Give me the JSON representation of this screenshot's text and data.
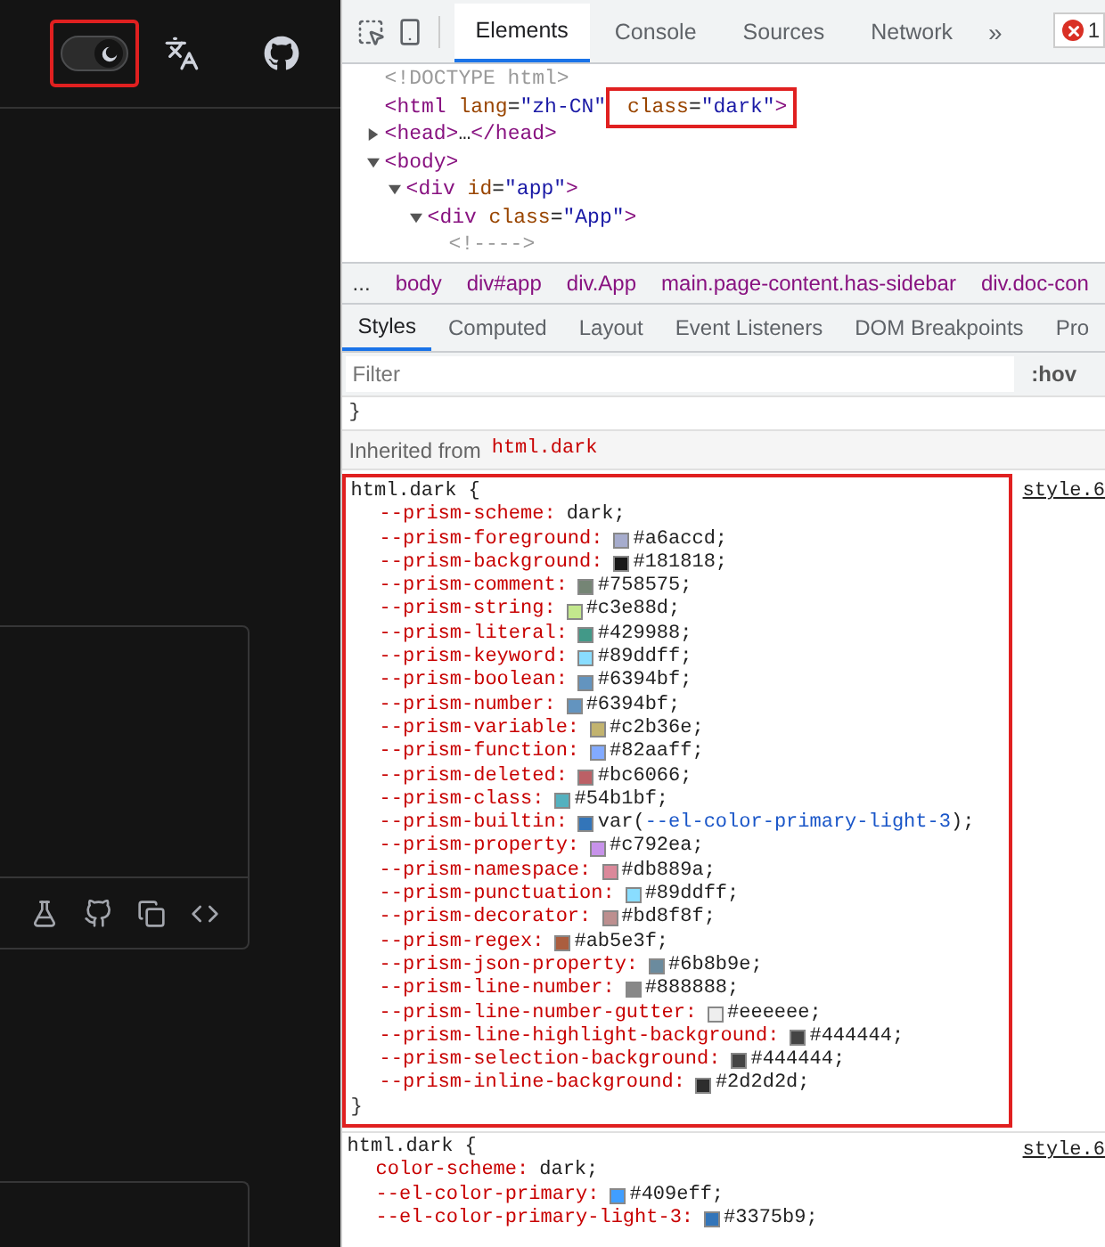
{
  "site_header": {
    "theme_switch": {
      "on": true
    }
  },
  "devtools": {
    "tabs": [
      {
        "label": "Elements",
        "selected": true
      },
      {
        "label": "Console",
        "selected": false
      },
      {
        "label": "Sources",
        "selected": false
      },
      {
        "label": "Network",
        "selected": false
      }
    ],
    "more_tabs": "»",
    "error_count": "1",
    "dom_tree": [
      {
        "tokens": [
          {
            "t": "<!DOCTYPE html>",
            "kind": "comment"
          }
        ]
      },
      {
        "tokens": [
          {
            "t": "<html",
            "kind": "tag"
          },
          {
            "t": " lang",
            "kind": "attr"
          },
          {
            "t": "=",
            "kind": "plain"
          },
          {
            "t": "\"zh-CN\"",
            "kind": "value"
          },
          {
            "t": " class",
            "kind": "attr",
            "boxed": true
          },
          {
            "t": "=",
            "kind": "plain",
            "boxed": true
          },
          {
            "t": "\"dark\"",
            "kind": "value",
            "boxed": true
          },
          {
            "t": ">",
            "kind": "tag",
            "boxed": true
          }
        ]
      },
      {
        "expanded": false,
        "tokens": [
          {
            "t": "<head>",
            "kind": "tag"
          },
          {
            "t": "…",
            "kind": "plain"
          },
          {
            "t": "</head>",
            "kind": "tag"
          }
        ]
      },
      {
        "expanded": true,
        "tokens": [
          {
            "t": "<body>",
            "kind": "tag"
          }
        ],
        "children": [
          {
            "expanded": true,
            "tokens": [
              {
                "t": "<div",
                "kind": "tag"
              },
              {
                "t": " id",
                "kind": "attr"
              },
              {
                "t": "=",
                "kind": "plain"
              },
              {
                "t": "\"app\"",
                "kind": "value"
              },
              {
                "t": ">",
                "kind": "tag"
              }
            ],
            "children": [
              {
                "expanded": true,
                "tokens": [
                  {
                    "t": "<div",
                    "kind": "tag"
                  },
                  {
                    "t": " class",
                    "kind": "attr"
                  },
                  {
                    "t": "=",
                    "kind": "plain"
                  },
                  {
                    "t": "\"App\"",
                    "kind": "value"
                  },
                  {
                    "t": ">",
                    "kind": "tag"
                  }
                ],
                "children": [
                  {
                    "tokens": [
                      {
                        "t": "<!---->",
                        "kind": "comment"
                      }
                    ]
                  }
                ]
              }
            ]
          }
        ]
      }
    ],
    "breadcrumbs": [
      "...",
      "body",
      "div#app",
      "div.App",
      "main.page-content.has-sidebar",
      "div.doc-con"
    ],
    "style_tabs": [
      {
        "label": "Styles",
        "selected": true
      },
      {
        "label": "Computed",
        "selected": false
      },
      {
        "label": "Layout",
        "selected": false
      },
      {
        "label": "Event Listeners",
        "selected": false
      },
      {
        "label": "DOM Breakpoints",
        "selected": false
      },
      {
        "label": "Pro",
        "selected": false
      }
    ],
    "filter": {
      "placeholder": "Filter",
      "hov": ":hov"
    },
    "closing_brace": "}",
    "inherited": {
      "label": "Inherited from",
      "selector": "html.dark"
    },
    "rules": [
      {
        "boxed": true,
        "selector": "html.dark {",
        "source": "style.6",
        "close": "}",
        "properties": [
          {
            "name": "--prism-scheme:",
            "value": "dark;"
          },
          {
            "name": "--prism-foreground:",
            "color": "#a6accd",
            "value": "#a6accd;"
          },
          {
            "name": "--prism-background:",
            "color": "#181818",
            "value": "#181818;"
          },
          {
            "name": "--prism-comment:",
            "color": "#758575",
            "value": "#758575;"
          },
          {
            "name": "--prism-string:",
            "color": "#c3e88d",
            "value": "#c3e88d;"
          },
          {
            "name": "--prism-literal:",
            "color": "#429988",
            "value": "#429988;"
          },
          {
            "name": "--prism-keyword:",
            "color": "#89ddff",
            "value": "#89ddff;"
          },
          {
            "name": "--prism-boolean:",
            "color": "#6394bf",
            "value": "#6394bf;"
          },
          {
            "name": "--prism-number:",
            "color": "#6394bf",
            "value": "#6394bf;"
          },
          {
            "name": "--prism-variable:",
            "color": "#c2b36e",
            "value": "#c2b36e;"
          },
          {
            "name": "--prism-function:",
            "color": "#82aaff",
            "value": "#82aaff;"
          },
          {
            "name": "--prism-deleted:",
            "color": "#bc6066",
            "value": "#bc6066;"
          },
          {
            "name": "--prism-class:",
            "color": "#54b1bf",
            "value": "#54b1bf;"
          },
          {
            "name": "--prism-builtin:",
            "color": "#3375b9",
            "value": "var(",
            "var_name": "--el-color-primary-light-3",
            "value_end": ");"
          },
          {
            "name": "--prism-property:",
            "color": "#c792ea",
            "value": "#c792ea;"
          },
          {
            "name": "--prism-namespace:",
            "color": "#db889a",
            "value": "#db889a;"
          },
          {
            "name": "--prism-punctuation:",
            "color": "#89ddff",
            "value": "#89ddff;"
          },
          {
            "name": "--prism-decorator:",
            "color": "#bd8f8f",
            "value": "#bd8f8f;"
          },
          {
            "name": "--prism-regex:",
            "color": "#ab5e3f",
            "value": "#ab5e3f;"
          },
          {
            "name": "--prism-json-property:",
            "color": "#6b8b9e",
            "value": "#6b8b9e;"
          },
          {
            "name": "--prism-line-number:",
            "color": "#888888",
            "value": "#888888;"
          },
          {
            "name": "--prism-line-number-gutter:",
            "color": "#eeeeee",
            "value": "#eeeeee;"
          },
          {
            "name": "--prism-line-highlight-background:",
            "color": "#444444",
            "value": "#444444;"
          },
          {
            "name": "--prism-selection-background:",
            "color": "#444444",
            "value": "#444444;"
          },
          {
            "name": "--prism-inline-background:",
            "color": "#2d2d2d",
            "value": "#2d2d2d;"
          }
        ]
      },
      {
        "boxed": false,
        "selector": "html.dark {",
        "source": "style.6",
        "properties": [
          {
            "name": "color-scheme:",
            "value": "dark;"
          },
          {
            "name": "--el-color-primary:",
            "color": "#409eff",
            "value": "#409eff;"
          },
          {
            "name": "--el-color-primary-light-3:",
            "color": "#3375b9",
            "value": "#3375b9;"
          }
        ]
      }
    ]
  }
}
